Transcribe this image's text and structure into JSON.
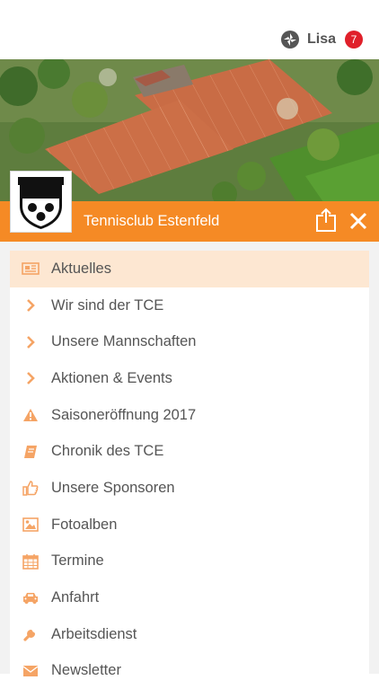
{
  "user": {
    "name": "Lisa",
    "notification_count": "7",
    "icon": "user-circle-icon"
  },
  "club": {
    "name": "Tennisclub Estenfeld",
    "logo_icon": "tce-crest-logo"
  },
  "actions": {
    "share_icon": "share-icon",
    "close_icon": "close-icon"
  },
  "colors": {
    "accent": "#f58a25",
    "active_bg": "#fde7d2",
    "badge": "#e0202a",
    "text": "#555555"
  },
  "menu": {
    "items": [
      {
        "label": "Aktuelles",
        "icon": "newspaper-icon",
        "active": true
      },
      {
        "label": "Wir sind der TCE",
        "icon": "chevron-right-icon"
      },
      {
        "label": "Unsere Mannschaften",
        "icon": "chevron-right-icon"
      },
      {
        "label": "Aktionen & Events",
        "icon": "chevron-right-icon"
      },
      {
        "label": "Saisoneröffnung 2017",
        "icon": "warning-icon"
      },
      {
        "label": "Chronik des TCE",
        "icon": "book-icon"
      },
      {
        "label": "Unsere Sponsoren",
        "icon": "thumbs-up-icon"
      },
      {
        "label": "Fotoalben",
        "icon": "image-icon"
      },
      {
        "label": "Termine",
        "icon": "calendar-icon"
      },
      {
        "label": "Anfahrt",
        "icon": "car-icon"
      },
      {
        "label": "Arbeitsdienst",
        "icon": "wrench-icon"
      },
      {
        "label": "Newsletter",
        "icon": "envelope-icon"
      }
    ]
  }
}
